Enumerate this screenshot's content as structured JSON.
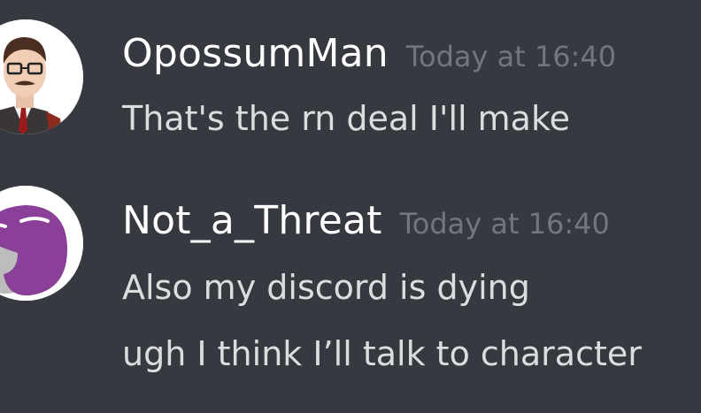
{
  "messages": [
    {
      "username": "OpossumMan",
      "timestamp": "Today at 16:40",
      "lines": [
        "That's the rn deal I'll make"
      ],
      "avatar_icon": "cartoon-man-avatar"
    },
    {
      "username": "Not_a_Threat",
      "timestamp": "Today at 16:40",
      "lines": [
        "Also my discord is dying",
        "ugh I think I’ll talk to character"
      ],
      "avatar_icon": "purple-blob-avatar"
    }
  ],
  "colors": {
    "background": "#36393f",
    "username": "#ffffff",
    "timestamp": "#72767d",
    "message_text": "#dcddde",
    "avatar_purple": "#8a3f98"
  }
}
